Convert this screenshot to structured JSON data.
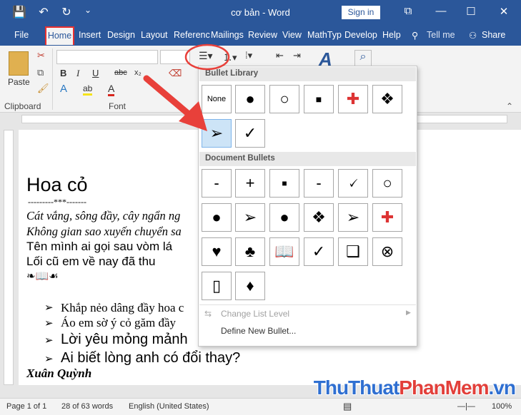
{
  "app": {
    "window_title": "cơ bản - Word",
    "sign_in": "Sign in"
  },
  "quick_access": {
    "save": "💾",
    "undo": "↶",
    "redo": "↻",
    "customize": "⌄"
  },
  "window_controls": {
    "restore_ribbon": "⧉",
    "minimize": "—",
    "maximize": "☐",
    "close": "✕"
  },
  "tabs": [
    "File",
    "Home",
    "Insert",
    "Design",
    "Layout",
    "Referenc",
    "Mailings",
    "Review",
    "View",
    "MathTyp",
    "Develop",
    "Help"
  ],
  "tell_me": "Tell me",
  "share": "Share",
  "ribbon": {
    "paste": "Paste",
    "clipboard_group": "Clipboard",
    "font_group": "Font",
    "bold": "B",
    "italic": "I",
    "underline": "U",
    "strike": "abc",
    "subscript": "x₂",
    "font_color": "A",
    "text_effects": "A",
    "highlight": "ab",
    "styles": "A",
    "find": "⌕"
  },
  "document": {
    "title": "Hoa cỏ",
    "separator": "---------***-------",
    "lines": [
      "Cát vắng, sông đầy, cây ngẩn ng",
      "Không gian sao xuyến chuyển sa",
      "Tên mình ai gọi sau vòm lá",
      "Lối cũ em về nay đã thu",
      "❧📖☙"
    ],
    "bullets": [
      "Khắp nẻo dâng đầy hoa c",
      "Áo em sờ ý cỏ găm đầy",
      "Lời yêu mỏng mảnh",
      "Ai biết lòng anh có đổi thay?"
    ],
    "author": "Xuân Quỳnh",
    "bullet_glyph": "➢"
  },
  "dropdown": {
    "bullet_library_title": "Bullet Library",
    "library": [
      "None",
      "●",
      "○",
      "■",
      "✚",
      "❖",
      "➢",
      "✓"
    ],
    "document_bullets_title": "Document Bullets",
    "doc_bullets": [
      "-",
      "+",
      "■",
      "-",
      "🗸",
      "○",
      "●",
      "➢",
      "●",
      "❖",
      "➢",
      "✚",
      "♥",
      "♣",
      "📖",
      "✓",
      "❑",
      "⊗",
      "▯",
      "♦"
    ],
    "change_level": "Change List Level",
    "define_new": "Define New Bullet..."
  },
  "status": {
    "page": "Page 1 of 1",
    "words": "28 of 63 words",
    "lang": "English (United States)",
    "zoom": "100%"
  },
  "watermark": {
    "part1": "ThuThuat",
    "part2": "PhanMem",
    "part3": ".vn"
  },
  "colors": {
    "brand": "#2b579a",
    "highlight_red": "#e83030",
    "arrow_red": "#e8403a"
  }
}
